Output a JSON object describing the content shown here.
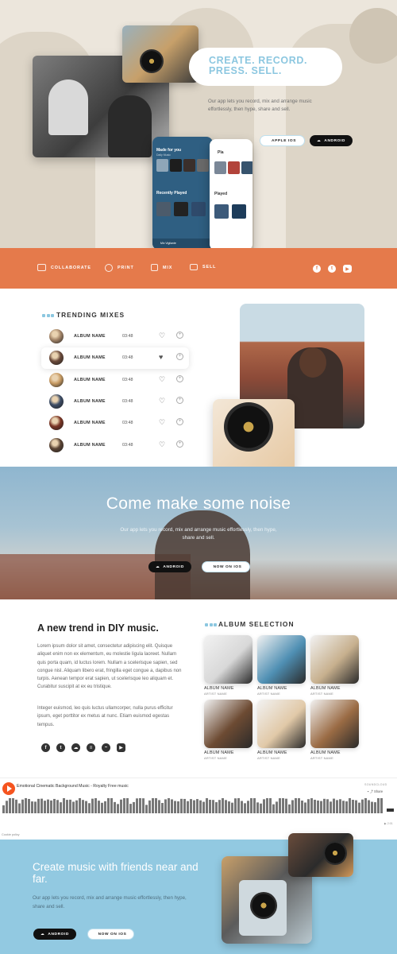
{
  "hero": {
    "title": "CREATE. RECORD. PRESS. SELL.",
    "description": "Our app lets you record, mix and arrange music effortlessly, then hype, share and sell.",
    "apple_button": "APPLE IOS",
    "android_button": "ANDROID",
    "phone_left": {
      "heading": "Made for you",
      "sub": "Daily Music",
      "recent": "Recently Played",
      "footer": "Mix Vigilante"
    },
    "phone_right": {
      "heading": "Pla",
      "recent": "Played"
    }
  },
  "nav": {
    "items": [
      "COLLABORATE",
      "PRINT",
      "MIX",
      "SELL"
    ],
    "icons": [
      "chat-icon",
      "print-icon",
      "mix-icon",
      "sell-icon"
    ],
    "socials": [
      "facebook-icon",
      "twitter-icon",
      "youtube-icon"
    ]
  },
  "trending": {
    "title": "TRENDING MIXES",
    "tracks": [
      {
        "name": "ALBUM NAME",
        "time": "03:48",
        "liked": false,
        "color": "#a6876a"
      },
      {
        "name": "ALBUM NAME",
        "time": "03:48",
        "liked": true,
        "color": "#6b4a3a"
      },
      {
        "name": "ALBUM NAME",
        "time": "03:48",
        "liked": false,
        "color": "#c89b63"
      },
      {
        "name": "ALBUM NAME",
        "time": "03:48",
        "liked": false,
        "color": "#3d4d66"
      },
      {
        "name": "ALBUM NAME",
        "time": "03:48",
        "liked": false,
        "color": "#7a3524"
      },
      {
        "name": "ALBUM NAME",
        "time": "03:48",
        "liked": false,
        "color": "#5b4434"
      }
    ],
    "heart_empty": "♡",
    "heart_full": "♥",
    "plus": "+"
  },
  "noise": {
    "title": "Come make some noise",
    "description": "Our app lets you record, mix and arrange music effortlessly, then hype, share and sell.",
    "android_button": "ANDROID",
    "ios_button": "NOW ON IOS"
  },
  "diy": {
    "title": "A new trend in DIY music.",
    "paragraph1": "Lorem ipsum dolor sit amet, consectetur adipiscing elit. Quisque aliquet enim non ex elementum, eu molestie ligula laoreet. Nullam quis porta quam, id luctus lorem. Nullam a scelerisque sapien, sed congue nisl. Aliquam libero erat, fringilla eget congue a, dapibus non turpis. Aenean tempor erat sapien, ut scelerisque leo aliquam et. Curabitur suscipit at ex eu tristique.",
    "paragraph2": "Integer euismod, leo quis luctus ullamcorper, nulla purus efficitur ipsum, eget porttitor ex metus at nunc. Etiam euismod egestas tempus.",
    "socials": [
      "facebook-icon",
      "twitter-icon",
      "soundcloud-icon",
      "spotify-icon",
      "messenger-icon",
      "youtube-icon"
    ]
  },
  "albums": {
    "title": "ALBUM SELECTION",
    "items": [
      {
        "name": "ALBUM NAME",
        "artist": "ARTIST NAME",
        "color": "#d8d8d8"
      },
      {
        "name": "ALBUM NAME",
        "artist": "ARTIST NAME",
        "color": "#4f8fb3"
      },
      {
        "name": "ALBUM NAME",
        "artist": "ARTIST NAME",
        "color": "#c7b08e"
      },
      {
        "name": "ALBUM NAME",
        "artist": "ARTIST NAME",
        "color": "#6d4b33"
      },
      {
        "name": "ALBUM NAME",
        "artist": "ARTIST NAME",
        "color": "#e1c9a8"
      },
      {
        "name": "ALBUM NAME",
        "artist": "ARTIST NAME",
        "color": "#9a6b44"
      }
    ]
  },
  "player": {
    "track_title": "Emotional Cinematic Background Music - Royalty Free music",
    "brand": "SOUNDCLOUD",
    "share": "Share",
    "duration": "2:01",
    "cookie": "Cookie policy",
    "accent": "#f5541f"
  },
  "cta": {
    "title": "Create music with friends near and far.",
    "description": "Our app lets you record, mix and arrange music effortlessly, then hype, share and sell.",
    "android_button": "ANDROID",
    "ios_button": "NOW ON IOS"
  },
  "colors": {
    "accent_blue": "#8cc7e0",
    "orange": "#e57a4b",
    "cta_blue": "#92c9e1"
  }
}
